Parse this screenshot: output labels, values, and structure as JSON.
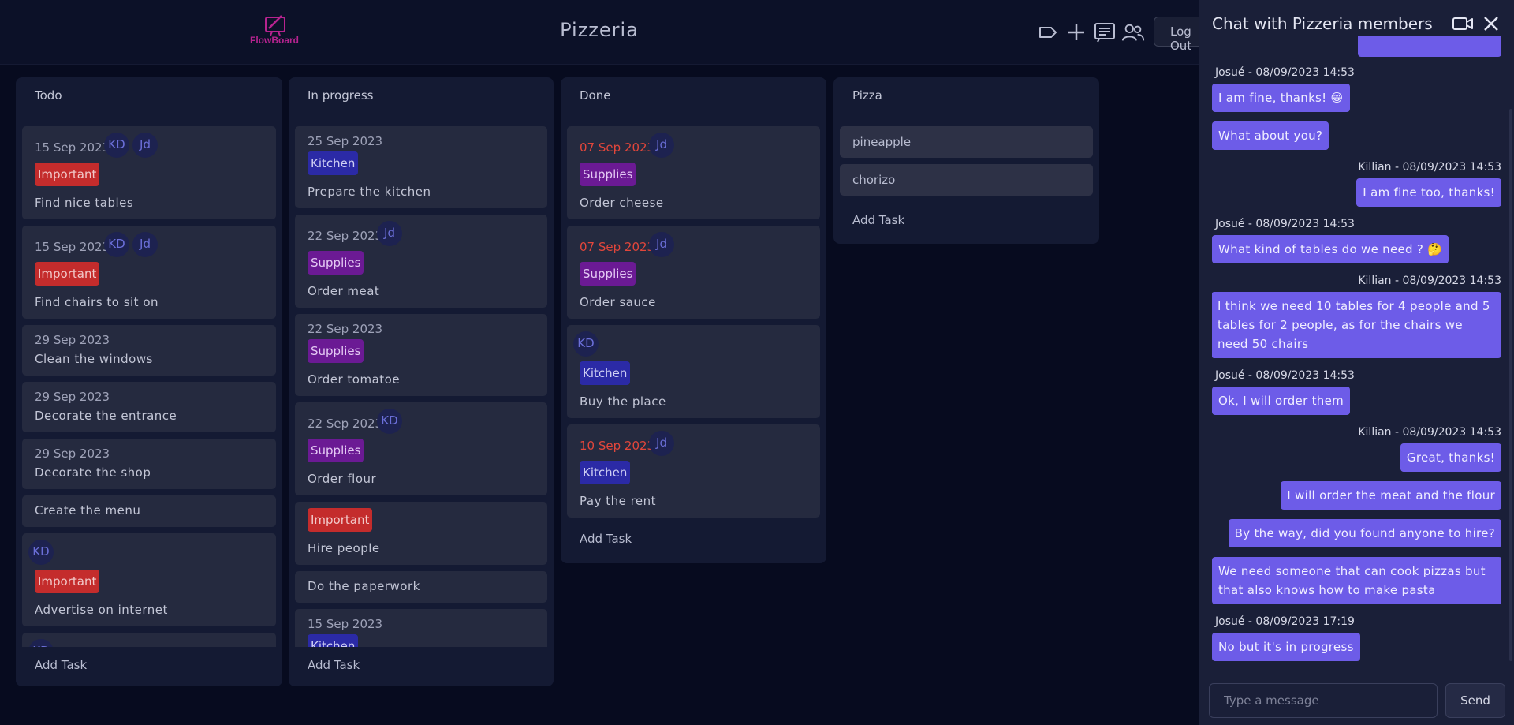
{
  "app": {
    "logo_text": "FlowBoard",
    "board_title": "Pizzeria",
    "logout_label": "Log Out"
  },
  "top_icons": [
    "label-icon",
    "plus-icon",
    "chat-list-icon",
    "members-icon"
  ],
  "columns": [
    {
      "title": "Todo",
      "add_task": "Add Task",
      "cards": [
        {
          "date": "15 Sep 2023",
          "avatars": [
            "KD",
            "Jd"
          ],
          "tag": "Important",
          "name": "Find nice tables"
        },
        {
          "date": "15 Sep 2023",
          "avatars": [
            "KD",
            "Jd"
          ],
          "tag": "Important",
          "name": "Find chairs to sit on"
        },
        {
          "date": "29 Sep 2023",
          "name": "Clean the windows"
        },
        {
          "date": "29 Sep 2023",
          "name": "Decorate the entrance"
        },
        {
          "date": "29 Sep 2023",
          "name": "Decorate the shop"
        },
        {
          "name": "Create the menu"
        },
        {
          "avatars": [
            "KD"
          ],
          "tag": "Important",
          "name": "Advertise on internet"
        },
        {
          "avatars": [
            "KD"
          ]
        }
      ]
    },
    {
      "title": "In progress",
      "add_task": "Add Task",
      "cards": [
        {
          "date": "25 Sep 2023",
          "tag": "Kitchen",
          "name": "Prepare the kitchen"
        },
        {
          "date": "22 Sep 2023",
          "avatars": [
            "Jd"
          ],
          "tag": "Supplies",
          "name": "Order meat"
        },
        {
          "date": "22 Sep 2023",
          "tag": "Supplies",
          "name": "Order tomatoe"
        },
        {
          "date": "22 Sep 2023",
          "avatars": [
            "KD"
          ],
          "tag": "Supplies",
          "name": "Order flour"
        },
        {
          "tag": "Important",
          "name": "Hire people"
        },
        {
          "name": "Do the paperwork"
        },
        {
          "date": "15 Sep 2023",
          "tag": "Kitchen"
        }
      ]
    },
    {
      "title": "Done",
      "add_task": "Add Task",
      "cards": [
        {
          "date": "07 Sep 2023",
          "avatars": [
            "Jd"
          ],
          "tag": "Supplies",
          "name": "Order cheese"
        },
        {
          "date": "07 Sep 2023",
          "avatars": [
            "Jd"
          ],
          "tag": "Supplies",
          "name": "Order sauce"
        },
        {
          "avatars": [
            "KD"
          ],
          "tag": "Kitchen",
          "name": "Buy the place"
        },
        {
          "date": "10 Sep 2023",
          "avatars": [
            "Jd"
          ],
          "tag": "Kitchen",
          "name": "Pay the rent"
        }
      ]
    },
    {
      "title": "Pizza",
      "add_task": "Add Task",
      "cards": [
        {
          "name": "pineapple"
        },
        {
          "name": "chorizo"
        }
      ]
    }
  ],
  "chat": {
    "title": "Chat with Pizzeria members",
    "input_placeholder": "Type a message",
    "send_label": "Send",
    "messages": [
      {
        "side": "right",
        "text": ""
      },
      {
        "meta": "Josué - 08/09/2023 14:53",
        "side": "left",
        "text": "I am fine, thanks! 😁"
      },
      {
        "side": "left",
        "text": "What about you?"
      },
      {
        "meta": "Killian - 08/09/2023 14:53",
        "side": "right",
        "text": "I am fine too, thanks!"
      },
      {
        "meta": "Josué - 08/09/2023 14:53",
        "side": "left",
        "text": "What kind of tables do we need ? 🤔"
      },
      {
        "meta": "Killian - 08/09/2023 14:53",
        "side": "right",
        "text": "I think we need 10 tables for 4 people and 5 tables for 2 people, as for the chairs we need 50 chairs"
      },
      {
        "meta": "Josué - 08/09/2023 14:53",
        "side": "left",
        "text": "Ok, I will order them"
      },
      {
        "meta": "Killian - 08/09/2023 14:53",
        "side": "right",
        "text": "Great, thanks!"
      },
      {
        "side": "right",
        "text": "I will order the meat and the flour"
      },
      {
        "side": "right",
        "text": "By the way, did you found anyone to hire?"
      },
      {
        "side": "right",
        "text": "We need someone that can cook pizzas but that also knows how to make pasta"
      },
      {
        "meta": "Josué - 08/09/2023 17:19",
        "side": "left",
        "text": "No but it's in progress"
      }
    ]
  },
  "colors": {
    "background": "#070b1f",
    "column": "#141a33",
    "card": "#252a3f",
    "important": "#c42c2c",
    "kitchen": "#2b2aa6",
    "supplies": "#6b1a94",
    "overdue": "#e2463b",
    "bubble": "#6d5ce8"
  }
}
